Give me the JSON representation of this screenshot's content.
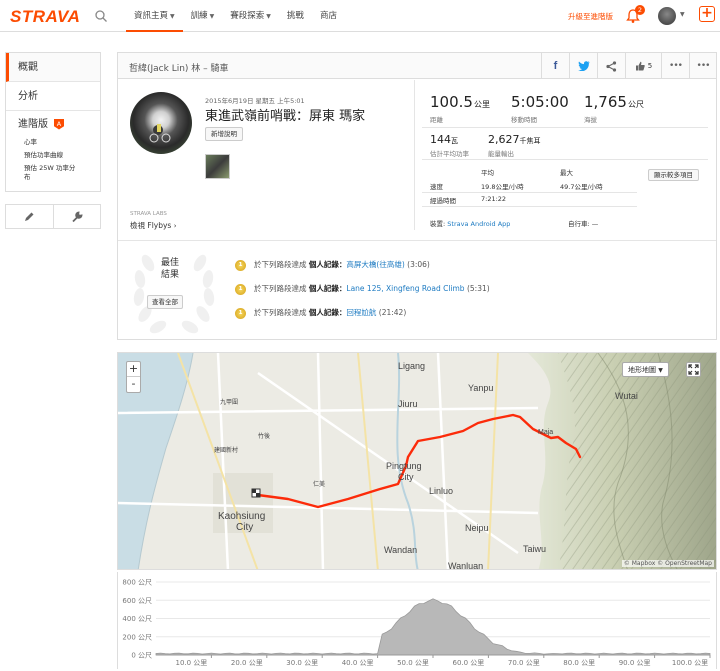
{
  "brand": "STRAVA",
  "nav": [
    {
      "label": "資訊主頁",
      "caret": true
    },
    {
      "label": "訓練",
      "caret": true
    },
    {
      "label": "賽段探索",
      "caret": true
    },
    {
      "label": "挑戰",
      "caret": false
    },
    {
      "label": "商店",
      "caret": false
    }
  ],
  "header": {
    "upgrade": "升級至進階版",
    "notification_count": "2"
  },
  "sidebar": {
    "items": [
      {
        "label": "概觀"
      },
      {
        "label": "分析"
      }
    ],
    "advanced": {
      "label": "進階版",
      "badge": "A"
    },
    "sub_items": [
      {
        "label": "心率"
      },
      {
        "label": "預估功率曲線"
      },
      {
        "label": "預估 25W 功率分布"
      }
    ]
  },
  "activity": {
    "header_title": "哲緯(Jack Lin) 林 – 騎車",
    "kudos_count": "5",
    "date": "2015年6月19日 星期五 上午5:01",
    "title": "東進武嶺前哨戰：屏東 瑪家",
    "add_description": "新增說明",
    "labs": "STRAVA LABS",
    "flybys": "檢視 Flybys"
  },
  "stats": {
    "distance": {
      "value": "100.5",
      "unit": "公里",
      "label": "距離"
    },
    "moving_time": {
      "value": "5:05:00",
      "label": "移動時間"
    },
    "elevation": {
      "value": "1,765",
      "unit": "公尺",
      "label": "海拔"
    },
    "power": {
      "value": "144",
      "unit": "瓦",
      "label": "估計平均功率"
    },
    "energy": {
      "value": "2,627",
      "unit": "千焦耳",
      "label": "能量輸出"
    },
    "table": {
      "col_avg": "平均",
      "col_max": "最大",
      "rows": [
        {
          "label": "速度",
          "avg": "19.8公里/小時",
          "max": "49.7公里/小時"
        },
        {
          "label": "經過時間",
          "avg": "7:21:22",
          "max": ""
        }
      ]
    },
    "show_more": "顯示較多項目",
    "device_label": "裝置:",
    "device": "Strava Android App",
    "bike_label": "自行車:",
    "bike": "—"
  },
  "best_efforts": {
    "title": "最佳結果",
    "view_all": "查看全部",
    "prefix": "於下列路段達成",
    "pr_label": "個人記錄：",
    "items": [
      {
        "medal": "1",
        "segment": "高屏大橋(往高雄)",
        "time": "(3:06)"
      },
      {
        "medal": "1",
        "segment": "Lane 125, Xingfeng Road Climb",
        "time": "(5:31)"
      },
      {
        "medal": "1",
        "segment": "回程尬航",
        "time": "(21:42)"
      }
    ]
  },
  "map": {
    "zoom_in": "+",
    "zoom_out": "-",
    "type_button": "地形地圖",
    "attribution": "© Mapbox © OpenStreetMap",
    "labels": [
      {
        "text": "Ligang",
        "size": 9
      },
      {
        "text": "Yanpu",
        "size": 9
      },
      {
        "text": "Jiuru",
        "size": 9
      },
      {
        "text": "Wutai",
        "size": 9
      },
      {
        "text": "Pingtung",
        "size": 9
      },
      {
        "text": "City",
        "size": 9
      },
      {
        "text": "Linluo",
        "size": 9
      },
      {
        "text": "Kaohsiung",
        "size": 10
      },
      {
        "text": "City",
        "size": 10
      },
      {
        "text": "Neipu",
        "size": 9
      },
      {
        "text": "Taiwu",
        "size": 9
      },
      {
        "text": "Wandan",
        "size": 9
      },
      {
        "text": "Wanluan",
        "size": 9
      },
      {
        "text": "Maja",
        "size": 7
      },
      {
        "text": "九甲圍",
        "size": 6
      },
      {
        "text": "建國新村",
        "size": 6
      },
      {
        "text": "竹後",
        "size": 6
      },
      {
        "text": "仁美",
        "size": 6
      }
    ]
  },
  "elevation_chart": {
    "y_ticks": [
      "800 公尺",
      "600 公尺",
      "400 公尺",
      "200 公尺",
      "0 公尺"
    ],
    "x_ticks": [
      "10.0 公里",
      "20.0 公里",
      "30.0 公里",
      "40.0 公里",
      "50.0 公里",
      "60.0 公里",
      "70.0 公里",
      "80.0 公里",
      "90.0 公里",
      "100.0 公里"
    ]
  }
}
